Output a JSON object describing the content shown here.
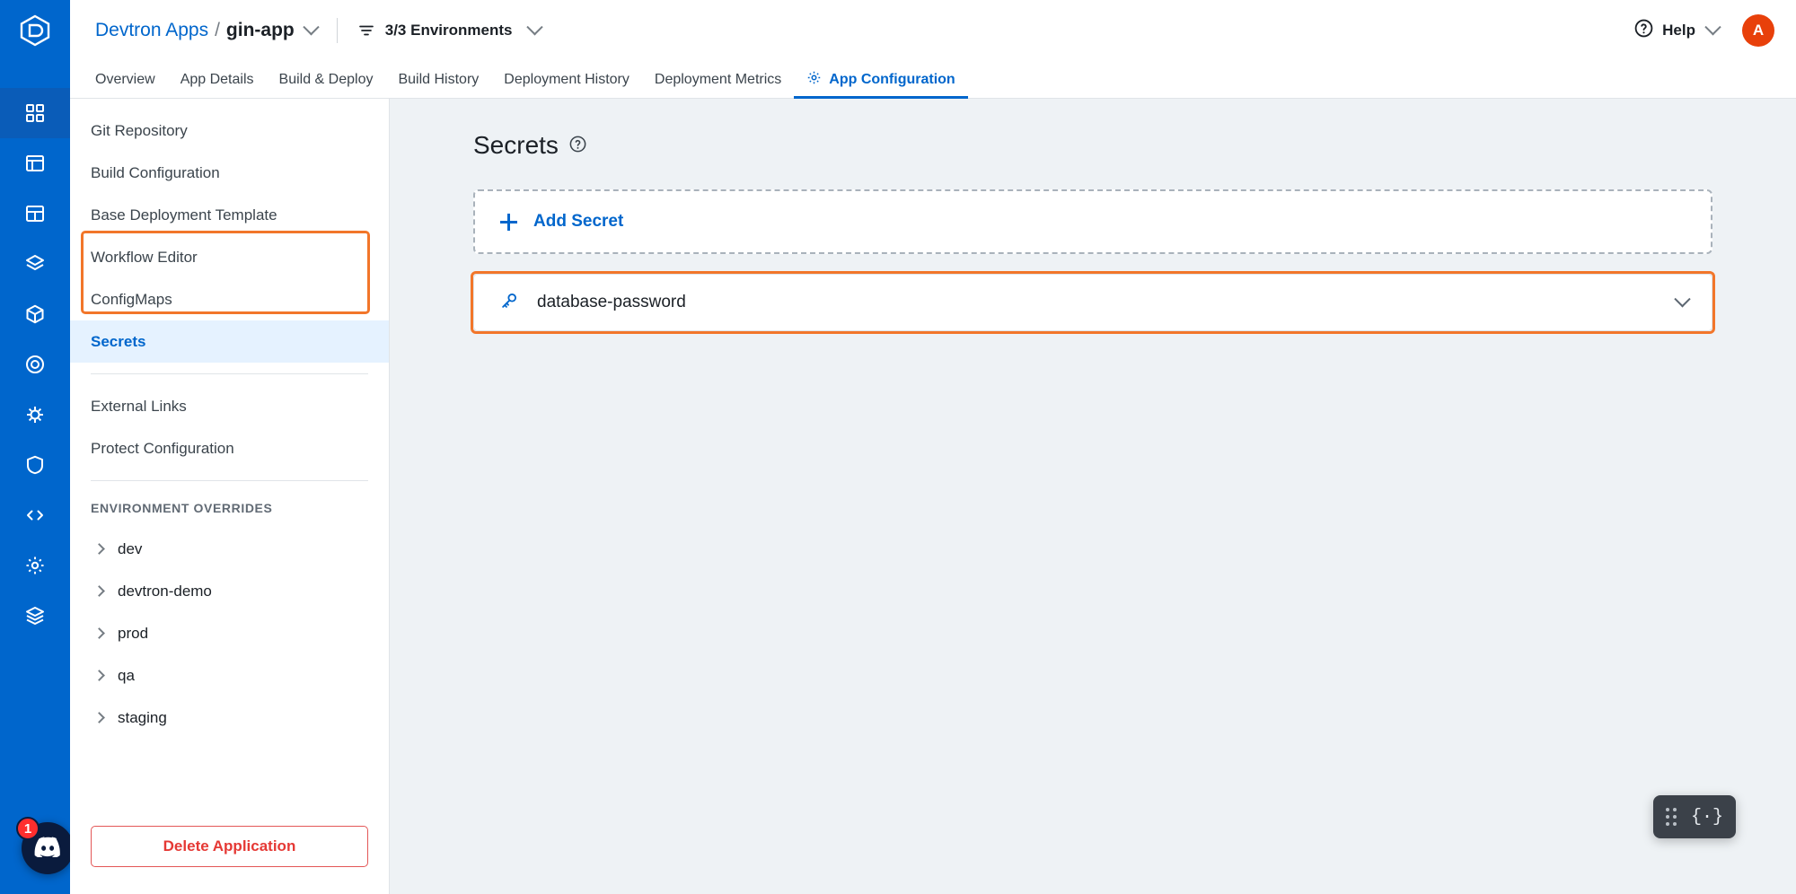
{
  "rail": {
    "logo_icon": "devtron-logo-icon",
    "items": [
      {
        "name": "applications",
        "icon": "grid-apps-icon",
        "active": true
      },
      {
        "name": "jobs",
        "icon": "table-jobs-icon",
        "active": false
      },
      {
        "name": "resource-browser",
        "icon": "squares-icon",
        "active": false
      },
      {
        "name": "chart-store",
        "icon": "layers-icon",
        "active": false
      },
      {
        "name": "deployment-groups",
        "icon": "cube-icon",
        "active": false
      },
      {
        "name": "clusters",
        "icon": "target-icon",
        "active": false
      },
      {
        "name": "bulk-edit",
        "icon": "bug-icon",
        "active": false
      },
      {
        "name": "security",
        "icon": "shield-icon",
        "active": false
      },
      {
        "name": "code",
        "icon": "code-brackets-icon",
        "active": false
      },
      {
        "name": "global-config",
        "icon": "gear-icon",
        "active": false
      },
      {
        "name": "stacks",
        "icon": "stack-icon",
        "active": false
      }
    ],
    "discord": {
      "icon": "discord-icon",
      "badge": "1"
    }
  },
  "header": {
    "breadcrumb_root": "Devtron Apps",
    "breadcrumb_separator": "/",
    "breadcrumb_current": "gin-app",
    "app_chevron_icon": "chevron-down-icon",
    "filter_icon": "filter-icon",
    "environments_label": "3/3 Environments",
    "env_chevron_icon": "chevron-down-icon",
    "help_icon": "question-circle-icon",
    "help_label": "Help",
    "help_chevron_icon": "chevron-down-icon",
    "avatar_initial": "A",
    "avatar_color": "#e8400a"
  },
  "tabs": [
    {
      "label": "Overview",
      "active": false,
      "icon": null
    },
    {
      "label": "App Details",
      "active": false,
      "icon": null
    },
    {
      "label": "Build & Deploy",
      "active": false,
      "icon": null
    },
    {
      "label": "Build History",
      "active": false,
      "icon": null
    },
    {
      "label": "Deployment History",
      "active": false,
      "icon": null
    },
    {
      "label": "Deployment Metrics",
      "active": false,
      "icon": null
    },
    {
      "label": "App Configuration",
      "active": true,
      "icon": "gear-icon"
    }
  ],
  "sidenav": {
    "items": [
      {
        "label": "Git Repository",
        "active": false
      },
      {
        "label": "Build Configuration",
        "active": false
      },
      {
        "label": "Base Deployment Template",
        "active": false
      },
      {
        "label": "Workflow Editor",
        "active": false
      },
      {
        "label": "ConfigMaps",
        "active": false
      },
      {
        "label": "Secrets",
        "active": true
      }
    ],
    "secondary_items": [
      {
        "label": "External Links",
        "active": false
      },
      {
        "label": "Protect Configuration",
        "active": false
      }
    ],
    "section_label": "ENVIRONMENT OVERRIDES",
    "environments": [
      {
        "label": "dev",
        "expand_icon": "chevron-right-icon"
      },
      {
        "label": "devtron-demo",
        "expand_icon": "chevron-right-icon"
      },
      {
        "label": "prod",
        "expand_icon": "chevron-right-icon"
      },
      {
        "label": "qa",
        "expand_icon": "chevron-right-icon"
      },
      {
        "label": "staging",
        "expand_icon": "chevron-right-icon"
      }
    ],
    "delete_label": "Delete Application",
    "highlight_color": "#f2762a"
  },
  "main": {
    "title": "Secrets",
    "title_help_icon": "question-circle-icon",
    "add_secret_label": "Add Secret",
    "add_secret_icon": "plus-icon",
    "secrets": [
      {
        "name": "database-password",
        "icon": "key-icon",
        "expand_icon": "chevron-down-icon",
        "highlighted": true
      }
    ],
    "highlight_color": "#f2762a"
  },
  "floating_widget": {
    "drag_icon": "drag-dots-icon",
    "code_icon": "curly-braces-icon",
    "code_glyph": "{·}"
  }
}
